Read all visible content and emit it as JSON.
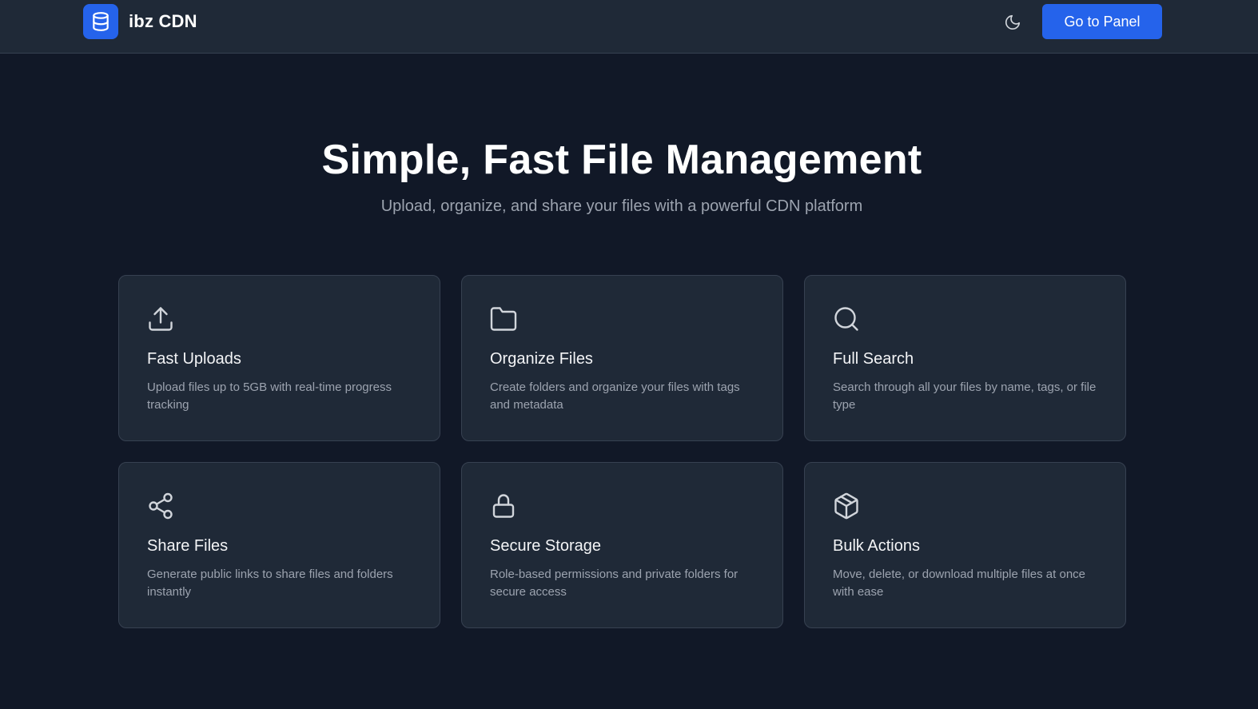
{
  "header": {
    "brand_name": "ibz CDN",
    "logo_icon": "database-icon",
    "theme_toggle_icon": "moon-icon",
    "panel_button_label": "Go to Panel"
  },
  "hero": {
    "title": "Simple, Fast File Management",
    "subtitle": "Upload, organize, and share your files with a powerful CDN platform"
  },
  "features": [
    {
      "icon": "upload-icon",
      "title": "Fast Uploads",
      "description": "Upload files up to 5GB with real-time progress tracking"
    },
    {
      "icon": "folder-icon",
      "title": "Organize Files",
      "description": "Create folders and organize your files with tags and metadata"
    },
    {
      "icon": "search-icon",
      "title": "Full Search",
      "description": "Search through all your files by name, tags, or file type"
    },
    {
      "icon": "share-icon",
      "title": "Share Files",
      "description": "Generate public links to share files and folders instantly"
    },
    {
      "icon": "lock-icon",
      "title": "Secure Storage",
      "description": "Role-based permissions and private folders for secure access"
    },
    {
      "icon": "package-icon",
      "title": "Bulk Actions",
      "description": "Move, delete, or download multiple files at once with ease"
    }
  ],
  "colors": {
    "background": "#111827",
    "surface": "#1f2937",
    "border": "#374151",
    "accent": "#2563eb",
    "text_muted": "#9ca3af"
  }
}
